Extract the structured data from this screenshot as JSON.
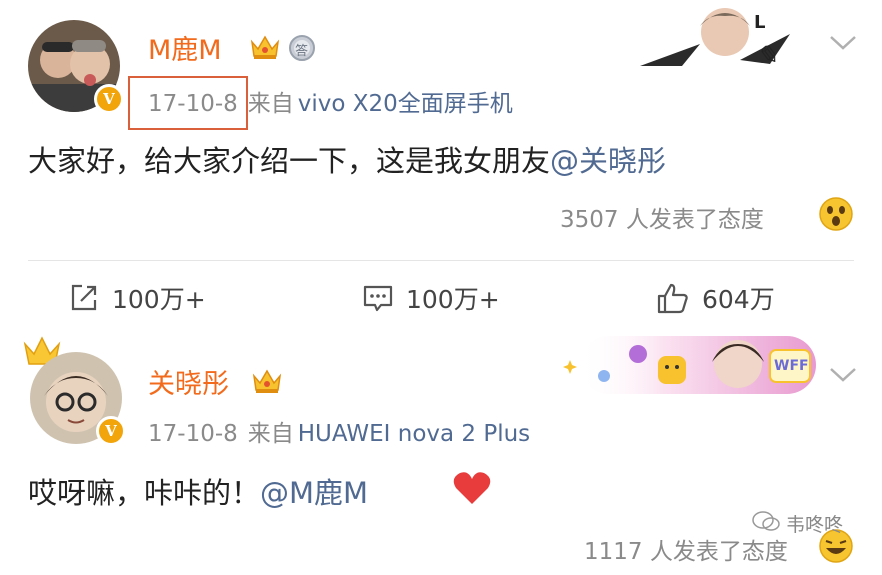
{
  "post1": {
    "username": "M鹿M",
    "date": "17-10-8",
    "via": "来自",
    "device": "vivo X20全面屏手机",
    "text": "大家好，给大家介绍一下，这是我女朋友",
    "mention": "@关晓彤",
    "reactions": "3507 人发表了态度",
    "actions": {
      "repost": "100万+",
      "comment": "100万+",
      "like": "604万"
    },
    "medal_label": "答"
  },
  "post2": {
    "username": "关晓彤",
    "date": "17-10-8",
    "via": "来自",
    "device": "HUAWEI nova 2 Plus",
    "text": "哎呀嘛，咔咔的！",
    "mention": "@M鹿M",
    "reactions": "1117 人发表了态度",
    "banner_text": "WFF"
  },
  "watermark": "韦咚咚",
  "colors": {
    "username": "#f26b1d",
    "link": "#506a92",
    "meta": "#8a8a8a",
    "highlight_box": "#d9603a",
    "badge": "#f2a40b"
  }
}
